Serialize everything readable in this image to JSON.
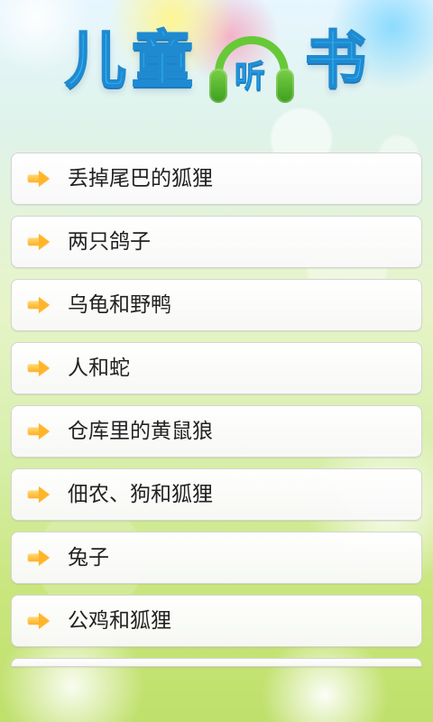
{
  "header": {
    "title_chars": [
      "儿",
      "童",
      "听",
      "书"
    ]
  },
  "icons": {
    "list_arrow": "arrow-right-icon",
    "headphones": "headphones-icon"
  },
  "theme": {
    "accent_blue": "#31b8f1",
    "accent_green": "#67c938",
    "list_bg": "#ffffff",
    "text": "#222222",
    "arrow_orange": "#ffb12a"
  },
  "stories": [
    {
      "label": "丢掉尾巴的狐狸"
    },
    {
      "label": "两只鸽子"
    },
    {
      "label": "乌龟和野鸭"
    },
    {
      "label": "人和蛇"
    },
    {
      "label": "仓库里的黄鼠狼"
    },
    {
      "label": "佃农、狗和狐狸"
    },
    {
      "label": "兔子"
    },
    {
      "label": "公鸡和狐狸"
    }
  ]
}
